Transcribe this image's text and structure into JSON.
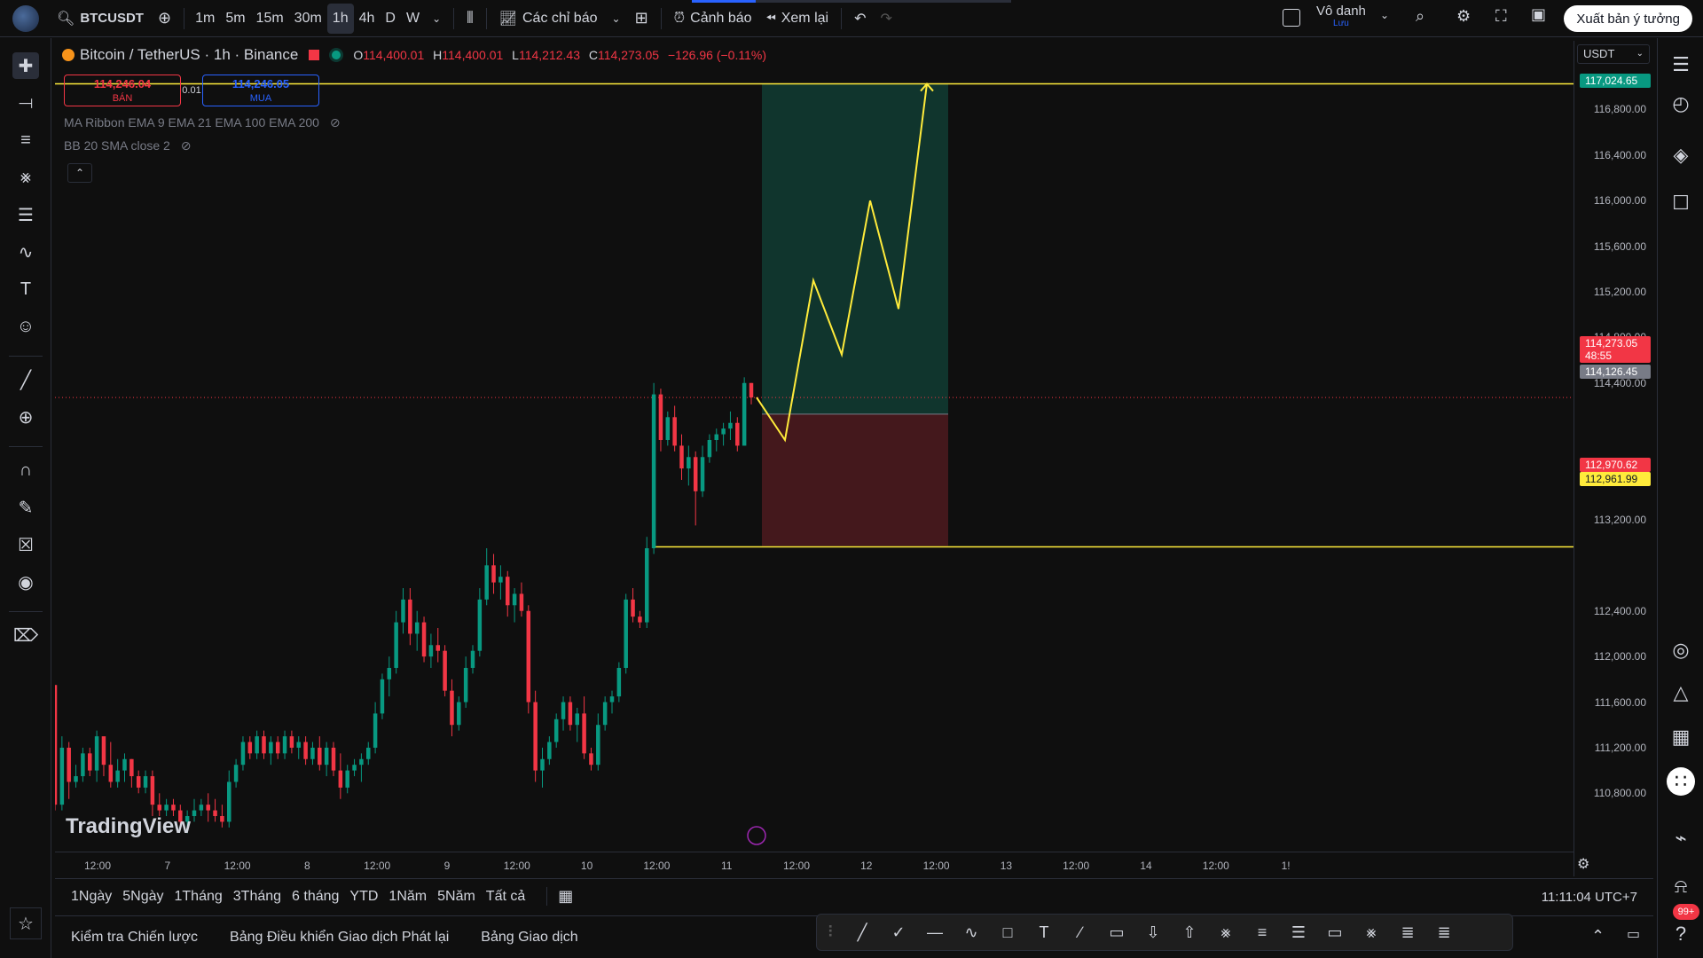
{
  "topbar": {
    "symbol": "BTCUSDT",
    "timeframes": [
      "1m",
      "5m",
      "15m",
      "30m",
      "1h",
      "4h",
      "D",
      "W"
    ],
    "active_timeframe": "1h",
    "indicators_label": "Các chỉ báo",
    "alert_label": "Cảnh báo",
    "replay_label": "Xem lại",
    "user_name": "Vô danh",
    "user_sub": "Lưu",
    "publish_label": "Xuất bản ý tưởng"
  },
  "legend": {
    "title": "Bitcoin / TetherUS · 1h · Binance",
    "o_label": "O",
    "o": "114,400.01",
    "h_label": "H",
    "h": "114,400.01",
    "l_label": "L",
    "l": "114,212.43",
    "c_label": "C",
    "c": "114,273.05",
    "change": "−126.96 (−0.11%)",
    "bid_price": "114,246.04",
    "bid_label": "BÁN",
    "spread": "0.01",
    "ask_price": "114,246.05",
    "ask_label": "MUA",
    "indicator1": "MA Ribbon EMA 9 EMA 21 EMA 100 EMA 200",
    "indicator2": "BB 20 SMA close 2"
  },
  "price_axis": {
    "currency": "USDT",
    "ticks": [
      "116,800.00",
      "116,400.00",
      "116,000.00",
      "115,600.00",
      "115,200.00",
      "114,800.00",
      "114,400.00",
      "113,600.00",
      "113,200.00",
      "112,400.00",
      "112,000.00",
      "111,600.00",
      "111,200.00",
      "110,800.00"
    ],
    "badge_target": "117,024.65",
    "badge_last": "114,273.05",
    "badge_countdown": "48:55",
    "badge_entry": "114,126.45",
    "badge_stop": "112,970.62",
    "badge_line": "112,961.99",
    "colors": {
      "up": "#089981",
      "down": "#f23645",
      "line": "#ffeb3b",
      "entry": "#787b86"
    }
  },
  "time_axis": {
    "ticks": [
      "12:00",
      "7",
      "12:00",
      "8",
      "12:00",
      "9",
      "12:00",
      "10",
      "12:00",
      "11",
      "12:00",
      "12",
      "12:00",
      "13",
      "12:00",
      "14",
      "12:00",
      "1!"
    ]
  },
  "watermark": "TradingView",
  "range_bar": {
    "ranges": [
      "1Ngày",
      "5Ngày",
      "1Tháng",
      "3Tháng",
      "6 tháng",
      "YTD",
      "1Năm",
      "5Năm",
      "Tất cả"
    ],
    "clock": "11:11:04 UTC+7"
  },
  "bottom_tabs": [
    "Kiểm tra Chiến lược",
    "Bảng Điều khiển Giao dịch Phát lại",
    "Bảng Giao dịch"
  ],
  "notifications_count": "99+",
  "chart_data": {
    "type": "candlestick",
    "price_range": [
      110600,
      117200
    ],
    "candles_ohlc": [
      [
        111750,
        111750,
        110650,
        110700
      ],
      [
        110700,
        111300,
        110650,
        111200
      ],
      [
        111200,
        111250,
        110750,
        110900
      ],
      [
        110900,
        111050,
        110850,
        110950
      ],
      [
        110950,
        111200,
        110900,
        111150
      ],
      [
        111150,
        111200,
        110950,
        111000
      ],
      [
        111000,
        111350,
        110900,
        111300
      ],
      [
        111300,
        111300,
        110950,
        111050
      ],
      [
        111050,
        111250,
        110850,
        110900
      ],
      [
        110900,
        111100,
        110850,
        111000
      ],
      [
        111000,
        111150,
        110900,
        111100
      ],
      [
        111100,
        111100,
        110850,
        110950
      ],
      [
        110950,
        111000,
        110800,
        110850
      ],
      [
        110850,
        111000,
        110800,
        110950
      ],
      [
        110950,
        111000,
        110600,
        110700
      ],
      [
        110700,
        110800,
        110600,
        110650
      ],
      [
        110650,
        110750,
        110600,
        110700
      ],
      [
        110700,
        110750,
        110600,
        110650
      ],
      [
        110650,
        110700,
        110500,
        110550
      ],
      [
        110550,
        110650,
        110450,
        110600
      ],
      [
        110600,
        110750,
        110550,
        110650
      ],
      [
        110650,
        110750,
        110600,
        110700
      ],
      [
        110700,
        110800,
        110550,
        110650
      ],
      [
        110650,
        110750,
        110550,
        110600
      ],
      [
        110600,
        110700,
        110500,
        110550
      ],
      [
        110550,
        111000,
        110500,
        110900
      ],
      [
        110900,
        111100,
        110850,
        111050
      ],
      [
        111050,
        111300,
        111000,
        111250
      ],
      [
        111250,
        111300,
        111100,
        111150
      ],
      [
        111150,
        111350,
        111100,
        111300
      ],
      [
        111300,
        111350,
        111100,
        111150
      ],
      [
        111150,
        111300,
        111050,
        111250
      ],
      [
        111250,
        111300,
        111100,
        111150
      ],
      [
        111150,
        111350,
        111100,
        111300
      ],
      [
        111300,
        111350,
        111150,
        111200
      ],
      [
        111200,
        111300,
        111100,
        111250
      ],
      [
        111250,
        111300,
        111050,
        111100
      ],
      [
        111100,
        111250,
        111050,
        111200
      ],
      [
        111200,
        111300,
        111000,
        111050
      ],
      [
        111050,
        111250,
        110950,
        111200
      ],
      [
        111200,
        111250,
        110950,
        111000
      ],
      [
        111000,
        111150,
        110750,
        110850
      ],
      [
        110850,
        111050,
        110800,
        111000
      ],
      [
        111000,
        111100,
        110950,
        111050
      ],
      [
        111050,
        111150,
        110900,
        111100
      ],
      [
        111100,
        111250,
        111050,
        111200
      ],
      [
        111200,
        111600,
        111150,
        111500
      ],
      [
        111500,
        111850,
        111450,
        111800
      ],
      [
        111800,
        112000,
        111650,
        111900
      ],
      [
        111900,
        112400,
        111850,
        112300
      ],
      [
        112300,
        112600,
        112200,
        112500
      ],
      [
        112500,
        112600,
        112100,
        112200
      ],
      [
        112200,
        112400,
        112050,
        112300
      ],
      [
        112300,
        112350,
        111950,
        112000
      ],
      [
        112000,
        112200,
        111900,
        112100
      ],
      [
        112100,
        112250,
        111950,
        112050
      ],
      [
        112050,
        112100,
        111650,
        111700
      ],
      [
        111700,
        111800,
        111300,
        111400
      ],
      [
        111400,
        111650,
        111350,
        111600
      ],
      [
        111600,
        112000,
        111550,
        111900
      ],
      [
        111900,
        112100,
        111850,
        112050
      ],
      [
        112050,
        112600,
        112000,
        112500
      ],
      [
        112500,
        112950,
        112450,
        112800
      ],
      [
        112800,
        112900,
        112550,
        112650
      ],
      [
        112650,
        112800,
        112500,
        112700
      ],
      [
        112700,
        112750,
        112350,
        112450
      ],
      [
        112450,
        112600,
        112300,
        112550
      ],
      [
        112550,
        112650,
        112350,
        112400
      ],
      [
        112400,
        112450,
        111500,
        111600
      ],
      [
        111600,
        111700,
        110900,
        111000
      ],
      [
        111000,
        111200,
        110850,
        111100
      ],
      [
        111100,
        111300,
        111050,
        111250
      ],
      [
        111250,
        111500,
        111200,
        111450
      ],
      [
        111450,
        111650,
        111350,
        111600
      ],
      [
        111600,
        111650,
        111350,
        111400
      ],
      [
        111400,
        111550,
        111250,
        111500
      ],
      [
        111500,
        111650,
        111100,
        111150
      ],
      [
        111150,
        111200,
        111000,
        111050
      ],
      [
        111050,
        111500,
        111000,
        111400
      ],
      [
        111400,
        111650,
        111350,
        111600
      ],
      [
        111600,
        111700,
        111500,
        111650
      ],
      [
        111650,
        111950,
        111600,
        111900
      ],
      [
        111900,
        112550,
        111850,
        112500
      ],
      [
        112500,
        112600,
        112300,
        112350
      ],
      [
        112350,
        112400,
        112250,
        112300
      ],
      [
        112300,
        113050,
        112250,
        112950
      ],
      [
        112950,
        114400,
        112900,
        114300
      ],
      [
        114300,
        114350,
        113800,
        113900
      ],
      [
        113900,
        114150,
        113850,
        114100
      ],
      [
        114100,
        114200,
        113800,
        113850
      ],
      [
        113850,
        113950,
        113550,
        113650
      ],
      [
        113650,
        113850,
        113500,
        113750
      ],
      [
        113750,
        113800,
        113150,
        113450
      ],
      [
        113450,
        113850,
        113400,
        113750
      ],
      [
        113750,
        113950,
        113700,
        113900
      ],
      [
        113900,
        114000,
        113800,
        113950
      ],
      [
        113950,
        114050,
        113850,
        114000
      ],
      [
        114000,
        114150,
        113900,
        114050
      ],
      [
        114050,
        114100,
        113800,
        113850
      ],
      [
        113850,
        114450,
        113850,
        114400
      ],
      [
        114400,
        114400,
        114212.43,
        114273.05
      ]
    ],
    "long_position": {
      "entry": 114126.45,
      "target": 117024.65,
      "stop": 112970.62
    },
    "horizontal_lines": [
      117024.65,
      112961.99
    ],
    "projection_path": [
      114273.05,
      113900,
      115300,
      114650,
      116000,
      115050,
      117024.65
    ]
  }
}
